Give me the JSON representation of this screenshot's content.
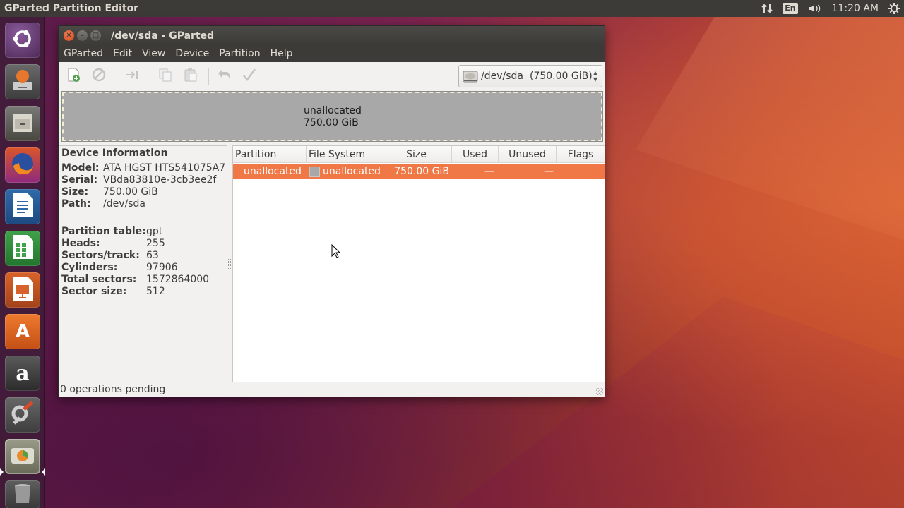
{
  "top_panel": {
    "app_title": "GParted Partition Editor",
    "keyboard_layout": "En",
    "clock": "11:20 AM",
    "icons": [
      "network-icon",
      "keyboard-layout-indicator",
      "sound-icon",
      "system-gear-icon"
    ]
  },
  "launcher": {
    "items": [
      {
        "name": "Dash",
        "icon": "ubuntu-logo-icon"
      },
      {
        "name": "Install Ubuntu",
        "icon": "installer-icon"
      },
      {
        "name": "Files",
        "icon": "file-cabinet-icon"
      },
      {
        "name": "Firefox",
        "icon": "firefox-icon"
      },
      {
        "name": "LibreOffice Writer",
        "icon": "writer-icon"
      },
      {
        "name": "LibreOffice Calc",
        "icon": "calc-icon"
      },
      {
        "name": "LibreOffice Impress",
        "icon": "impress-icon"
      },
      {
        "name": "Ubuntu Software",
        "icon": "software-center-icon"
      },
      {
        "name": "Amazon",
        "icon": "amazon-icon"
      },
      {
        "name": "System Settings",
        "icon": "settings-icon"
      },
      {
        "name": "GParted",
        "icon": "gparted-icon"
      },
      {
        "name": "Trash",
        "icon": "trash-icon"
      }
    ],
    "amazon_glyph": "a",
    "software_glyph": "A"
  },
  "window": {
    "title": "/dev/sda - GParted",
    "menu": [
      "GParted",
      "Edit",
      "View",
      "Device",
      "Partition",
      "Help"
    ],
    "device_selector": {
      "device": "/dev/sda",
      "size": "(750.00 GiB)"
    },
    "disk_graphic": {
      "label": "unallocated",
      "size": "750.00 GiB"
    },
    "device_info": {
      "heading": "Device Information",
      "rows_top": [
        {
          "key": "Model:",
          "value": "ATA HGST HTS541075A7"
        },
        {
          "key": "Serial:",
          "value": "VBda83810e-3cb3ee2f"
        },
        {
          "key": "Size:",
          "value": "750.00 GiB"
        },
        {
          "key": "Path:",
          "value": "/dev/sda"
        }
      ],
      "rows_bottom": [
        {
          "key": "Partition table:",
          "value": "gpt"
        },
        {
          "key": "Heads:",
          "value": "255"
        },
        {
          "key": "Sectors/track:",
          "value": "63"
        },
        {
          "key": "Cylinders:",
          "value": "97906"
        },
        {
          "key": "Total sectors:",
          "value": "1572864000"
        },
        {
          "key": "Sector size:",
          "value": "512"
        }
      ]
    },
    "table": {
      "columns": [
        "Partition",
        "File System",
        "Size",
        "Used",
        "Unused",
        "Flags"
      ],
      "rows": [
        {
          "partition": "unallocated",
          "file_system": "unallocated",
          "size": "750.00 GiB",
          "used": "—",
          "unused": "—",
          "flags": ""
        }
      ],
      "selected_row_color": "#f07746"
    },
    "status": "0 operations pending"
  },
  "colors": {
    "panel": "#3c3b37",
    "window_bg": "#f2f1f0",
    "accent_orange": "#f07746",
    "unallocated_gray": "#a8a8a8"
  }
}
